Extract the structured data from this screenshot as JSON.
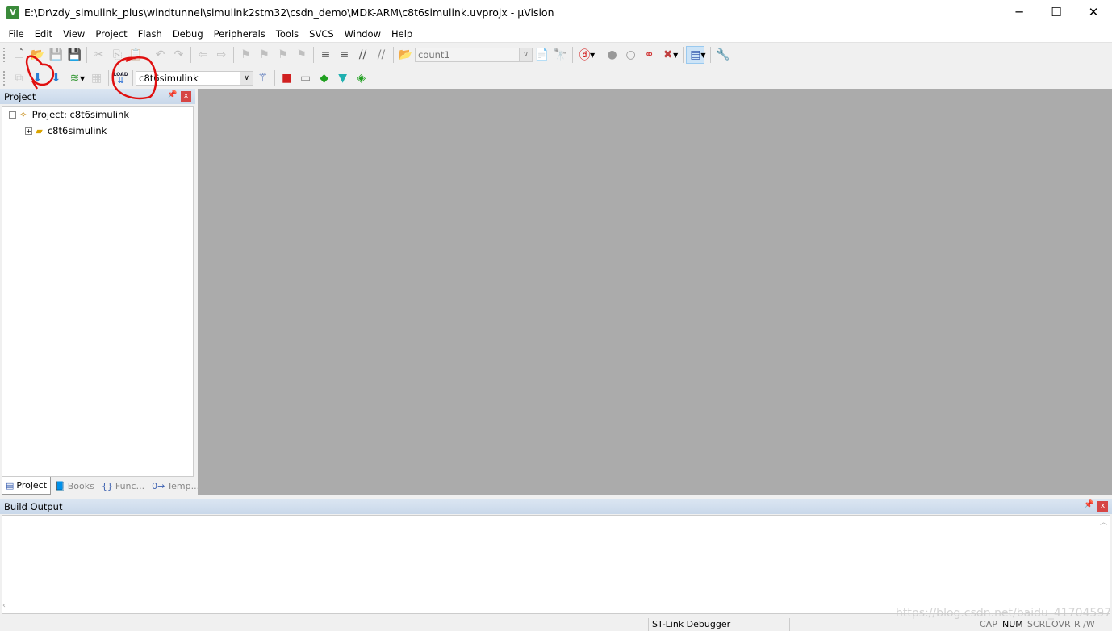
{
  "window": {
    "title": "E:\\Dr\\zdy_simulink_plus\\windtunnel\\simulink2stm32\\csdn_demo\\MDK-ARM\\c8t6simulink.uvprojx - µVision",
    "app_icon": "V",
    "minimize": "─",
    "maximize": "☐",
    "close": "✕"
  },
  "menu": [
    "File",
    "Edit",
    "View",
    "Project",
    "Flash",
    "Debug",
    "Peripherals",
    "Tools",
    "SVCS",
    "Window",
    "Help"
  ],
  "toolbar1": {
    "group1": [
      {
        "name": "new-file-icon",
        "g": "🗋",
        "c": "#777"
      },
      {
        "name": "open-file-icon",
        "g": "📂",
        "c": "#d9a400"
      },
      {
        "name": "save-icon",
        "g": "💾",
        "c": "#888",
        "dis": true
      },
      {
        "name": "save-all-icon",
        "g": "💾",
        "c": "#4a4aa8"
      }
    ],
    "group2": [
      {
        "name": "cut-icon",
        "g": "✂",
        "c": "#777",
        "dis": true
      },
      {
        "name": "copy-icon",
        "g": "⎘",
        "c": "#777",
        "dis": true
      },
      {
        "name": "paste-icon",
        "g": "📋",
        "c": "#777",
        "dis": true
      }
    ],
    "group3": [
      {
        "name": "undo-icon",
        "g": "↶",
        "c": "#777",
        "dis": true
      },
      {
        "name": "redo-icon",
        "g": "↷",
        "c": "#777",
        "dis": true
      }
    ],
    "group4": [
      {
        "name": "nav-back-icon",
        "g": "⇦",
        "c": "#777",
        "dis": true
      },
      {
        "name": "nav-forward-icon",
        "g": "⇨",
        "c": "#777",
        "dis": true
      }
    ],
    "group5": [
      {
        "name": "bookmark-icon",
        "g": "⚑",
        "c": "#777",
        "dis": true
      },
      {
        "name": "prev-bookmark-icon",
        "g": "⚑",
        "c": "#777",
        "dis": true
      },
      {
        "name": "next-bookmark-icon",
        "g": "⚑",
        "c": "#777",
        "dis": true
      },
      {
        "name": "clear-bookmarks-icon",
        "g": "⚑",
        "c": "#777",
        "dis": true
      }
    ],
    "group6": [
      {
        "name": "indent-icon",
        "g": "≡",
        "c": "#555"
      },
      {
        "name": "unindent-icon",
        "g": "≡",
        "c": "#555"
      },
      {
        "name": "comment-icon",
        "g": "//",
        "c": "#555"
      },
      {
        "name": "uncomment-icon",
        "g": "//",
        "c": "#888"
      }
    ],
    "find_in_files_icon": "📂",
    "search_combo": "count1",
    "group7": [
      {
        "name": "find-icon",
        "g": "📄",
        "c": "#3a5fb0"
      },
      {
        "name": "incremental-find-icon",
        "g": "🔭",
        "c": "#888",
        "dis": true
      }
    ],
    "debug_session": {
      "name": "start-debug-icon",
      "g": "ⓓ",
      "c": "#d00000"
    },
    "group8": [
      {
        "name": "insert-breakpoint-icon",
        "g": "●",
        "c": "#999"
      },
      {
        "name": "enable-breakpoint-icon",
        "g": "○",
        "c": "#999"
      },
      {
        "name": "disable-breakpoints-icon",
        "g": "⚭",
        "c": "#d03030"
      },
      {
        "name": "kill-breakpoints-icon",
        "g": "✖",
        "c": "#c04040"
      }
    ],
    "window_layout": {
      "name": "window-layout-icon",
      "g": "▤",
      "c": "#3a5fb0"
    },
    "configure": {
      "name": "configure-wrench-icon",
      "g": "🔧",
      "c": "#3a5fb0"
    }
  },
  "toolbar2": {
    "group1": [
      {
        "name": "translate-icon",
        "g": "⧉",
        "c": "#999",
        "dis": true
      },
      {
        "name": "build-icon",
        "g": "⬇",
        "c": "#2a7fd4"
      },
      {
        "name": "rebuild-icon",
        "g": "⬇",
        "c": "#2a7fd4"
      },
      {
        "name": "batch-build-icon",
        "g": "≋",
        "c": "#3a9a3a"
      }
    ],
    "stop_build": {
      "name": "stop-build-icon",
      "g": "▦",
      "c": "#999",
      "dis": true
    },
    "load": {
      "name": "load-download-icon",
      "label": "LOAD"
    },
    "target_combo": "c8t6simulink",
    "group2": [
      {
        "name": "target-options-icon",
        "g": "⚚",
        "c": "#3a5fb0"
      }
    ],
    "group3": [
      {
        "name": "manage-components-icon",
        "g": "■",
        "c": "#d02020"
      },
      {
        "name": "select-packs-icon",
        "g": "▭",
        "c": "#888"
      },
      {
        "name": "pack-installer-icon",
        "g": "◆",
        "c": "#20a020"
      },
      {
        "name": "manage-run-env-icon",
        "g": "▼",
        "c": "#20b0b0"
      },
      {
        "name": "event-recorder-icon",
        "g": "◈",
        "c": "#20a020"
      }
    ]
  },
  "project_panel": {
    "title": "Project",
    "pin": "📌",
    "close": "x",
    "root": "Project: c8t6simulink",
    "target": "c8t6simulink",
    "tabs": [
      {
        "label": "Project",
        "icon": "▤"
      },
      {
        "label": "Books",
        "icon": "📘"
      },
      {
        "label": "Func...",
        "icon": "{}"
      },
      {
        "label": "Temp...",
        "icon": "0→"
      }
    ]
  },
  "build_output": {
    "title": "Build Output",
    "pin": "📌",
    "close": "x",
    "text": ""
  },
  "status": {
    "debugger": "ST-Link Debugger",
    "indicators": [
      {
        "label": "CAP",
        "on": false
      },
      {
        "label": "NUM",
        "on": true
      },
      {
        "label": "SCRL",
        "on": false
      },
      {
        "label": "OVR",
        "on": false
      },
      {
        "label": "R /W",
        "on": false
      }
    ]
  },
  "watermark": "https://blog.csdn.net/baidu_41704597",
  "colors": {
    "workspace": "#ababab",
    "annotation": "#e01010",
    "panel_header": "#d2dfee"
  }
}
